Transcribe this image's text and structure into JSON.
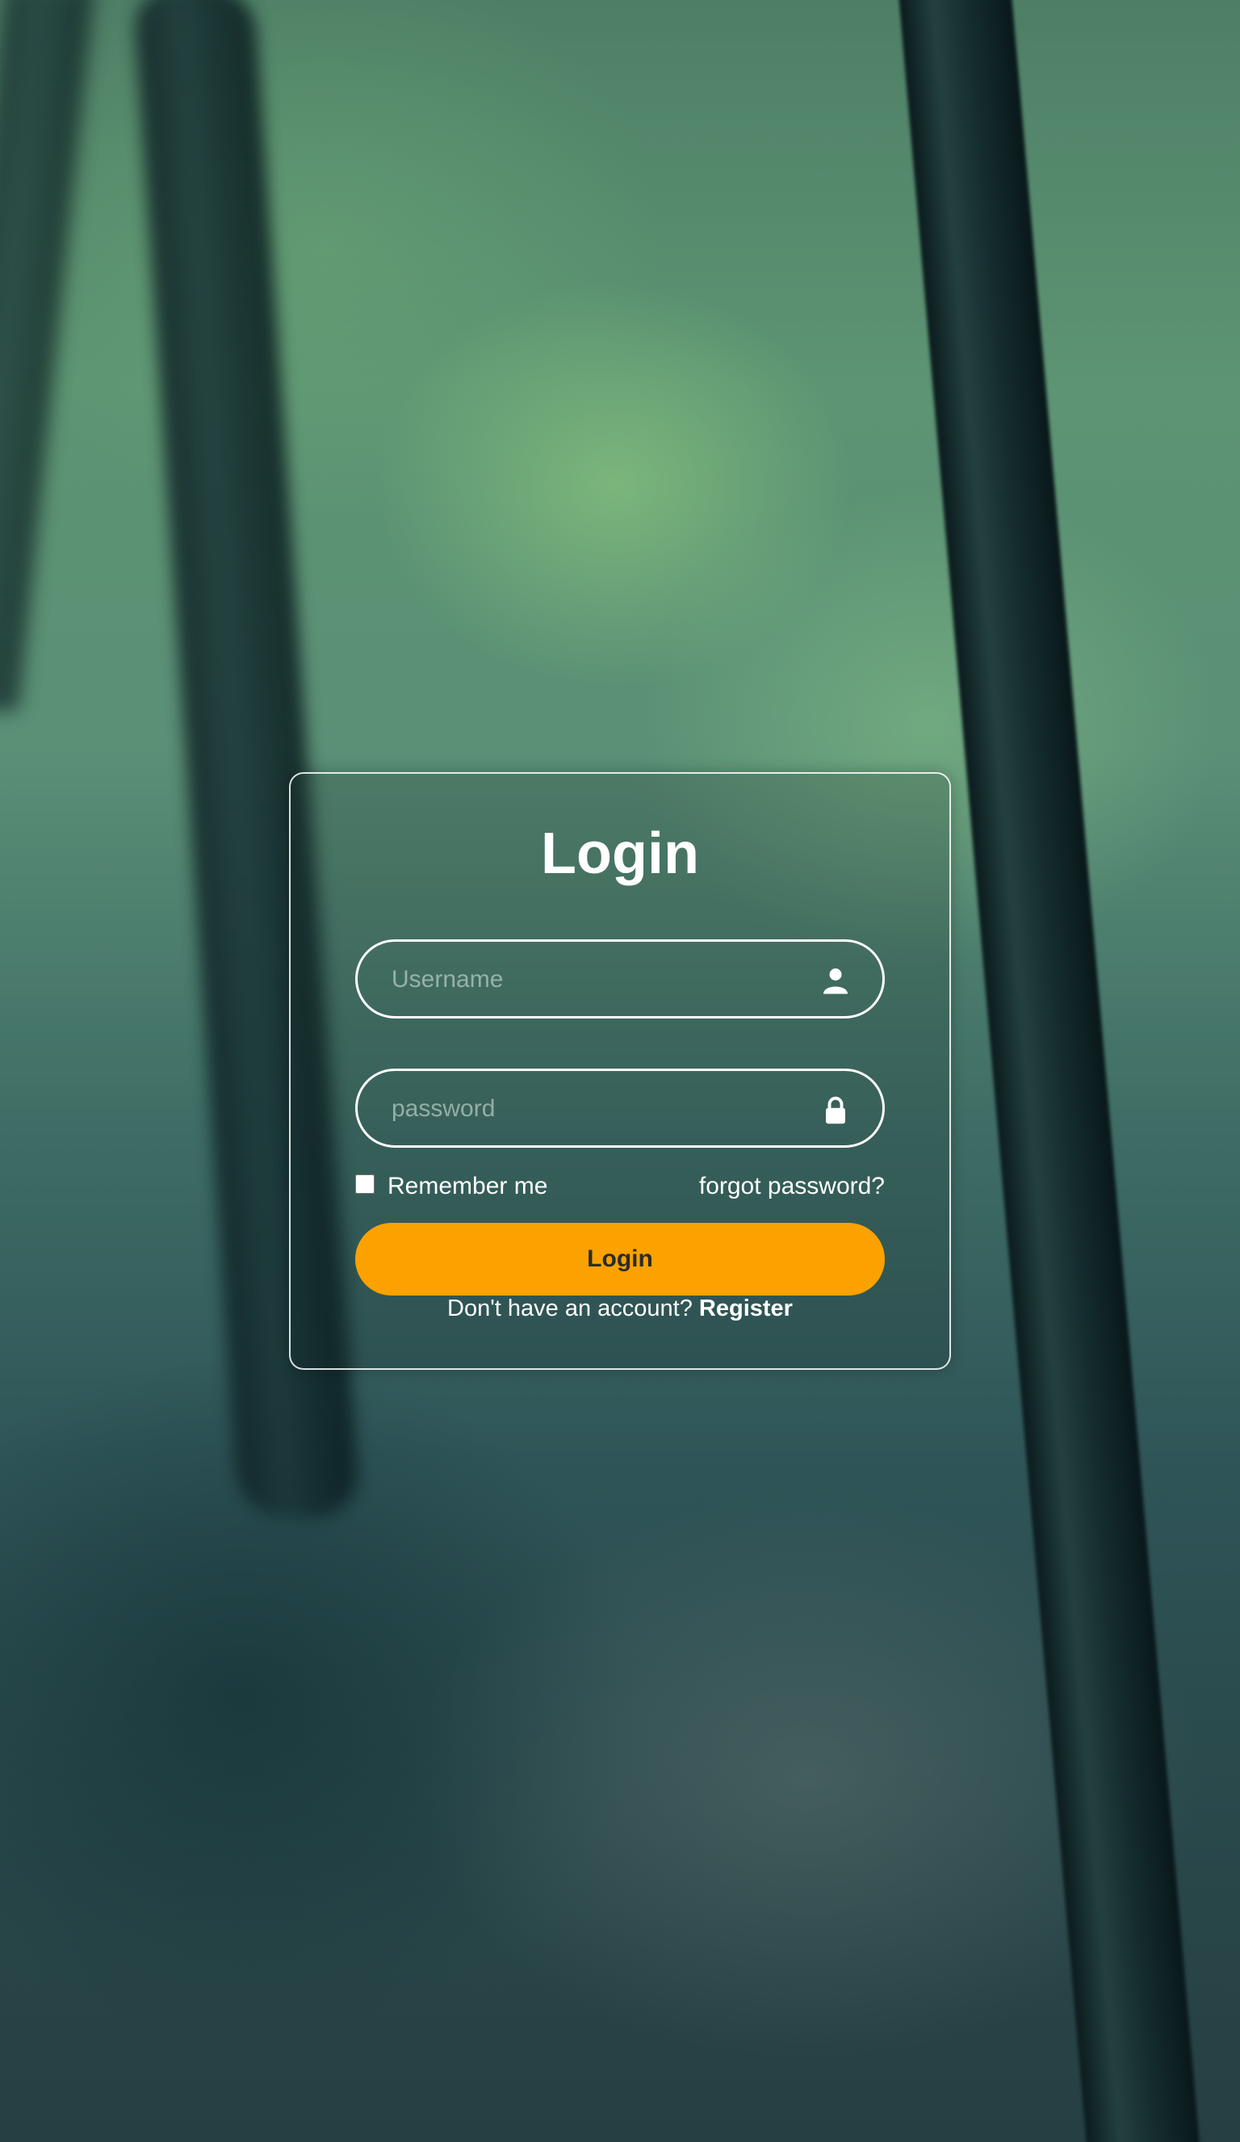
{
  "login": {
    "title": "Login",
    "username_placeholder": "Username",
    "password_placeholder": "password",
    "username_icon": "user-icon",
    "password_icon": "lock-icon",
    "remember_label": "Remember me",
    "forgot_label": "forgot password?",
    "button_label": "Login",
    "register_prompt": "Don't have an account?",
    "register_link": "Register"
  },
  "colors": {
    "accent": "#fba200",
    "text": "#ffffff"
  }
}
